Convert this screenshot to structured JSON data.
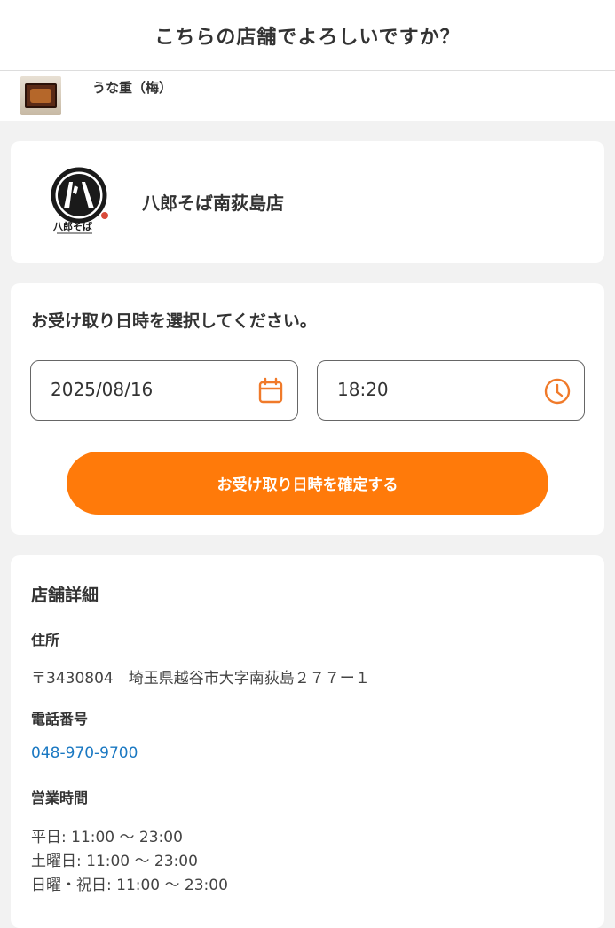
{
  "header": {
    "title": "こちらの店舗でよろしいですか？"
  },
  "item": {
    "name": "うな重（梅）"
  },
  "store": {
    "name": "八郎そば南荻島店",
    "logo_text": "八郎そば"
  },
  "pickup": {
    "heading": "お受け取り日時を選択してください。",
    "date_value": "2025/08/16",
    "time_value": "18:20",
    "confirm_label": "お受け取り日時を確定する"
  },
  "details": {
    "heading": "店舗詳細",
    "address_label": "住所",
    "address_value": "〒3430804　埼玉県越谷市大字南荻島２７７ー１",
    "phone_label": "電話番号",
    "phone_value": "048-970-9700",
    "hours_label": "営業時間",
    "hours": [
      "平日: 11:00 〜 23:00",
      "土曜日: 11:00 〜 23:00",
      "日曜・祝日: 11:00 〜 23:00"
    ]
  },
  "colors": {
    "accent": "#ff7a0a",
    "link": "#1a78c2",
    "icon": "#f07a2a"
  }
}
